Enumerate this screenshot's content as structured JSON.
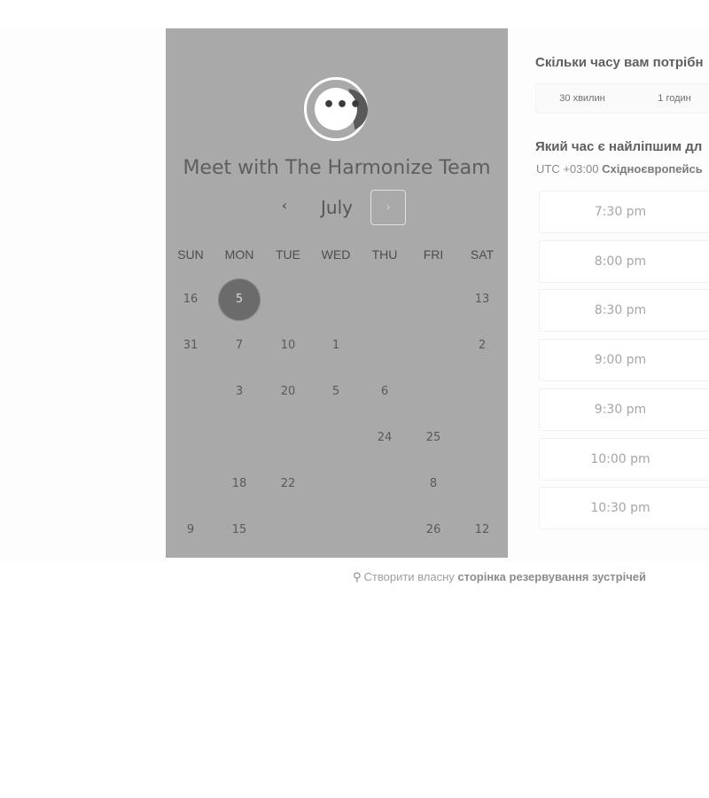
{
  "calendar": {
    "title": "Meet with The Harmonize Team",
    "month": "July",
    "prev_glyph": "‹",
    "next_glyph": "›",
    "weekdays": [
      "SUN",
      "MON",
      "TUE",
      "WED",
      "THU",
      "FRI",
      "SAT"
    ],
    "weeks": [
      [
        "16",
        "5",
        "",
        "",
        "",
        "",
        "13"
      ],
      [
        "31",
        "7",
        "10",
        "1",
        "",
        "",
        "2"
      ],
      [
        "",
        "3",
        "20",
        "5",
        "6",
        "",
        ""
      ],
      [
        "",
        "",
        "",
        "",
        "24",
        "25",
        ""
      ],
      [
        "",
        "18",
        "22",
        "",
        "",
        "8",
        ""
      ],
      [
        "9",
        "15",
        "",
        "",
        "",
        "26",
        "12"
      ]
    ],
    "selected_day": "5"
  },
  "duration": {
    "question": "Скільки часу вам потрібн",
    "options": [
      "30 хвилин",
      "1 годин"
    ]
  },
  "time": {
    "question": "Який час є найліпшим дл",
    "tz_prefix": "UTC +03:00 ",
    "tz_name": "Східноєвропейсь",
    "slots": [
      "7:30 pm",
      "8:00 pm",
      "8:30 pm",
      "9:00 pm",
      "9:30 pm",
      "10:00 pm",
      "10:30 pm"
    ]
  },
  "footer": {
    "icon": "sprocket-icon",
    "text": "Створити власну ",
    "link": "сторінка резервування зустрічей"
  },
  "colors": {
    "panel": "#a9a9a9",
    "selected_day": "#6b6b6b"
  }
}
